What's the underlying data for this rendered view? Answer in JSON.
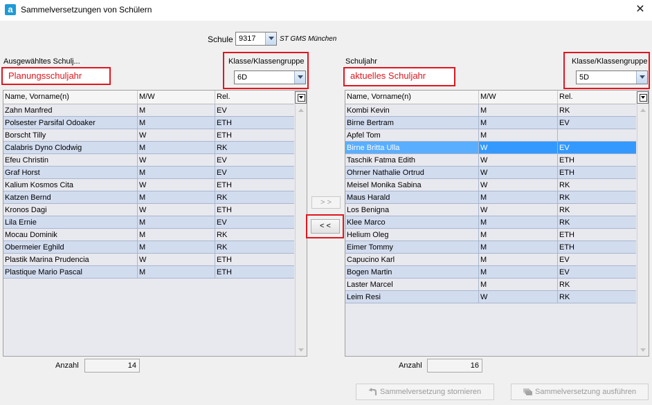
{
  "window": {
    "title": "Sammelversetzungen von Schülern",
    "icon_letter": "a",
    "close": "✕"
  },
  "schule": {
    "label": "Schule",
    "value": "9317",
    "name": "ST GMS München"
  },
  "left": {
    "heading": "Ausgewähltes Schulj...",
    "annotation": "Planungsschuljahr",
    "klasse_label": "Klasse/Klassengruppe",
    "klasse_value": "6D",
    "columns": [
      "Name, Vorname(n)",
      "M/W",
      "Rel."
    ],
    "rows": [
      [
        "Zahn Manfred",
        "M",
        "EV"
      ],
      [
        "Polsester Parsifal Odoaker",
        "M",
        "ETH"
      ],
      [
        "Borscht Tilly",
        "W",
        "ETH"
      ],
      [
        "Calabris Dyno Clodwig",
        "M",
        "RK"
      ],
      [
        "Efeu Christin",
        "W",
        "EV"
      ],
      [
        "Graf Horst",
        "M",
        "EV"
      ],
      [
        "Kalium Kosmos Cita",
        "W",
        "ETH"
      ],
      [
        "Katzen Bernd",
        "M",
        "RK"
      ],
      [
        "Kronos Dagi",
        "W",
        "ETH"
      ],
      [
        "Lila Ernie",
        "M",
        "EV"
      ],
      [
        "Mocau Dominik",
        "M",
        "RK"
      ],
      [
        "Obermeier Eghild",
        "M",
        "RK"
      ],
      [
        "Plastik Marina Prudencia",
        "W",
        "ETH"
      ],
      [
        "Plastique Mario Pascal",
        "M",
        "ETH"
      ]
    ],
    "count_label": "Anzahl",
    "count_value": "14"
  },
  "right": {
    "heading": "Schuljahr",
    "annotation": "aktuelles Schuljahr",
    "klasse_label": "Klasse/Klassengruppe",
    "klasse_value": "5D",
    "columns": [
      "Name, Vorname(n)",
      "M/W",
      "Rel."
    ],
    "rows": [
      [
        "Kombi Kevin",
        "M",
        "RK"
      ],
      [
        "Birne Bertram",
        "M",
        "EV"
      ],
      [
        "Apfel Tom",
        "M",
        ""
      ],
      [
        "Birne Britta Ulla",
        "W",
        "EV"
      ],
      [
        "Taschik Fatma Edith",
        "W",
        "ETH"
      ],
      [
        "Ohrner Nathalie Ortrud",
        "W",
        "ETH"
      ],
      [
        "Meisel Monika Sabina",
        "W",
        "RK"
      ],
      [
        "Maus Harald",
        "M",
        "RK"
      ],
      [
        "Los Benigna",
        "W",
        "RK"
      ],
      [
        "Klee Marco",
        "M",
        "RK"
      ],
      [
        "Helium Oleg",
        "M",
        "ETH"
      ],
      [
        "Eimer Tommy",
        "M",
        "ETH"
      ],
      [
        "Capucino Karl",
        "M",
        "EV"
      ],
      [
        "Bogen Martin",
        "M",
        "EV"
      ],
      [
        "Laster Marcel",
        "M",
        "RK"
      ],
      [
        "Leim Resi",
        "W",
        "RK"
      ]
    ],
    "selected_index": 3,
    "count_label": "Anzahl",
    "count_value": "16"
  },
  "transfer": {
    "right_label": "> >",
    "left_label": "< <"
  },
  "footer": {
    "cancel_label": "Sammelversetzung stornieren",
    "execute_label": "Sammelversetzung ausführen"
  },
  "colors": {
    "annotation_red": "#e0151d",
    "selection_blue": "#3399ff",
    "row_alt": "#d2dcef"
  }
}
